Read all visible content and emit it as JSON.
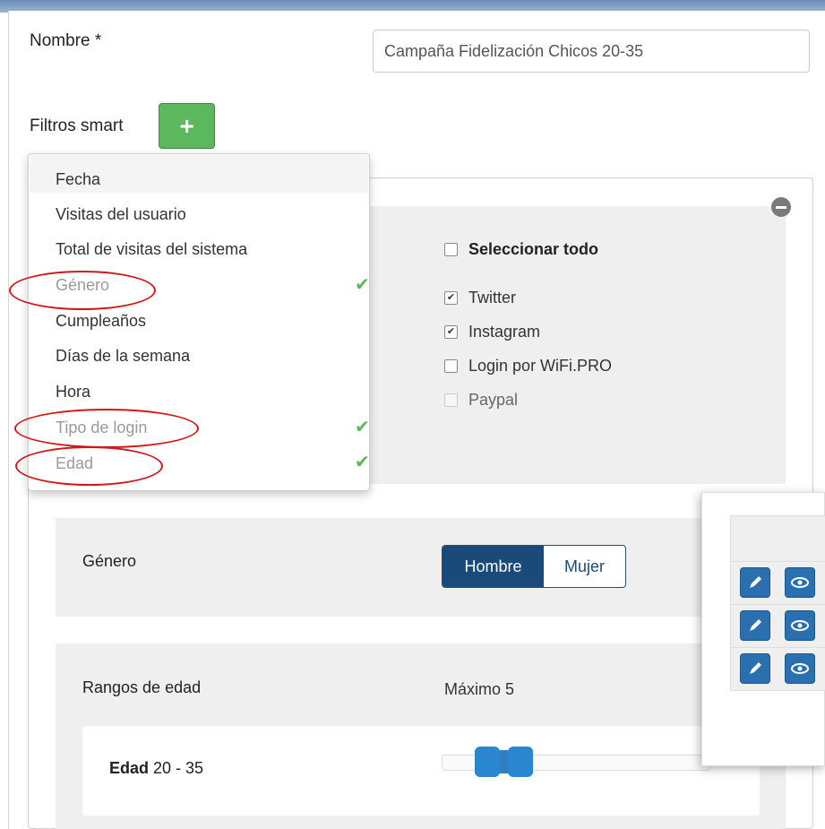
{
  "form": {
    "name_label": "Nombre *",
    "name_value": "Campaña Fidelización Chicos 20-35",
    "filters_label": "Filtros smart",
    "add_filter_symbol": "+"
  },
  "dropdown": {
    "items": [
      {
        "label": "Fecha",
        "active": false
      },
      {
        "label": "Visitas del usuario",
        "active": false
      },
      {
        "label": "Total de visitas del sistema",
        "active": false
      },
      {
        "label": "Género",
        "active": true
      },
      {
        "label": "Cumpleaños",
        "active": false
      },
      {
        "label": "Días de la semana",
        "active": false
      },
      {
        "label": "Hora",
        "active": false
      },
      {
        "label": "Tipo de login",
        "active": true
      },
      {
        "label": "Edad",
        "active": true
      }
    ],
    "check_icon": "check-icon",
    "highlight_color": "#d0181a"
  },
  "login_filter": {
    "select_all_label": "Seleccionar todo",
    "select_all_checked": false,
    "options": [
      {
        "label": "Twitter",
        "checked": true,
        "disabled": false
      },
      {
        "label": "Instagram",
        "checked": true,
        "disabled": false
      },
      {
        "label": "Login por WiFi.PRO",
        "checked": false,
        "disabled": false
      },
      {
        "label": "Paypal",
        "checked": false,
        "disabled": true
      }
    ]
  },
  "gender_filter": {
    "label": "Género",
    "options": [
      "Hombre",
      "Mujer"
    ],
    "selected": "Hombre"
  },
  "age_filter": {
    "label": "Rangos de edad",
    "max_note": "Máximo 5",
    "range_label": "Edad",
    "range_value": "20 - 35",
    "range_min": 20,
    "range_max": 35
  },
  "table": {
    "row_count": 3,
    "edit_icon": "pencil-icon",
    "view_icon": "eye-icon"
  },
  "colors": {
    "primary": "#1a4a7a",
    "success": "#5cb85c",
    "slider": "#2a86cf"
  }
}
